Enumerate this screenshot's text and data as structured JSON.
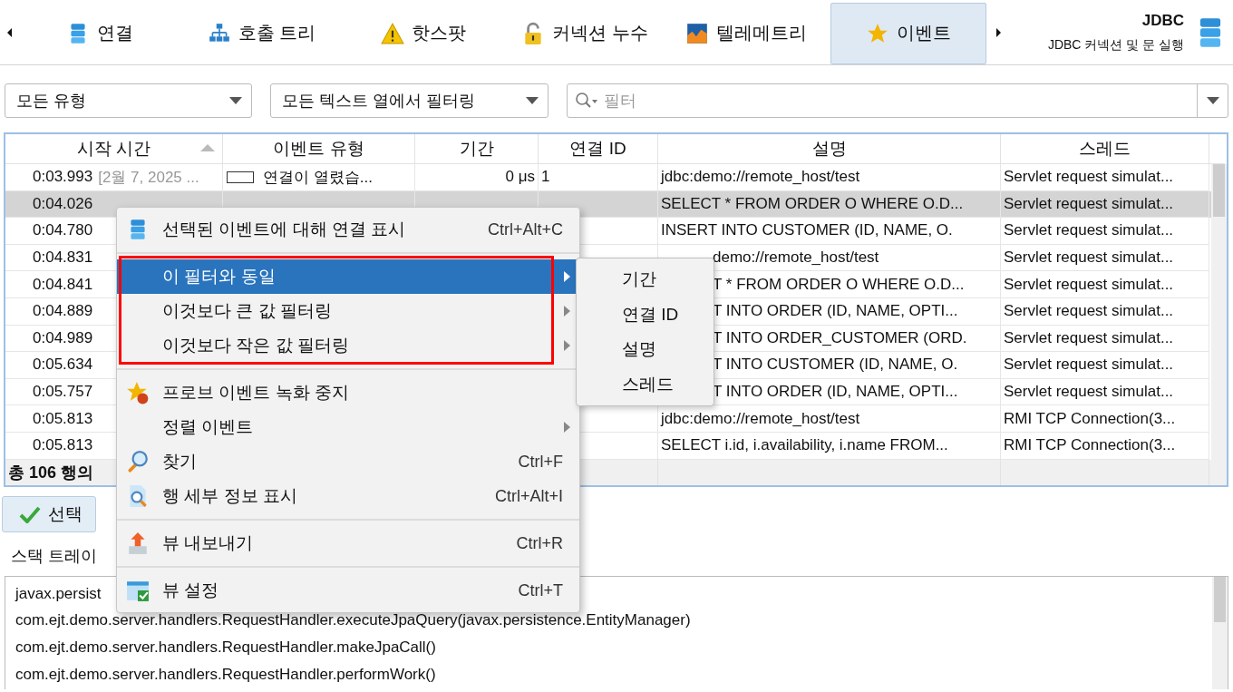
{
  "toolbar": {
    "tabs": [
      {
        "label": "연결",
        "selected": false
      },
      {
        "label": "호출 트리",
        "selected": false
      },
      {
        "label": "핫스팟",
        "selected": false
      },
      {
        "label": "커넥션 누수",
        "selected": false
      },
      {
        "label": "텔레메트리",
        "selected": false
      },
      {
        "label": "이벤트",
        "selected": true
      }
    ]
  },
  "header": {
    "title": "JDBC",
    "subtitle": "JDBC 커넥션 및 문 실행"
  },
  "filters": {
    "type_dropdown": "모든 유형",
    "column_dropdown": "모든 텍스트 열에서 필터링",
    "search": {
      "placeholder": "필터"
    }
  },
  "table": {
    "columns": [
      {
        "label": "시작 시간",
        "sorted": true
      },
      {
        "label": "이벤트 유형",
        "sorted": false
      },
      {
        "label": "기간",
        "sorted": false
      },
      {
        "label": "연결 ID",
        "sorted": false
      },
      {
        "label": "설명",
        "sorted": false
      },
      {
        "label": "스레드",
        "sorted": false
      }
    ],
    "rows": [
      {
        "start": "0:03.993",
        "date": "[2월 7, 2025 ...",
        "event_type": "연결이 열렸습...",
        "color": "#ffffff",
        "duration": "0 μs",
        "connection_id": "1",
        "description": "jdbc:demo://remote_host/test",
        "thread": "Servlet request simulat...",
        "selected": false
      },
      {
        "start": "0:04.026",
        "description": "SELECT * FROM ORDER O WHERE O.D...",
        "thread": "Servlet request simulat...",
        "selected": true
      },
      {
        "start": "0:04.780",
        "description": "INSERT INTO CUSTOMER (ID, NAME, O.",
        "thread": "Servlet request simulat...",
        "selected": false
      },
      {
        "start": "0:04.831",
        "description": "demo://remote_host/test",
        "thread": "Servlet request simulat...",
        "selected": false
      },
      {
        "start": "0:04.841",
        "description": "T * FROM ORDER O WHERE O.D...",
        "thread": "Servlet request simulat...",
        "selected": false
      },
      {
        "start": "0:04.889",
        "description": "T INTO ORDER (ID, NAME, OPTI...",
        "thread": "Servlet request simulat...",
        "selected": false
      },
      {
        "start": "0:04.989",
        "description": "T INTO ORDER_CUSTOMER (ORD.",
        "thread": "Servlet request simulat...",
        "selected": false
      },
      {
        "start": "0:05.634",
        "description": "T INTO CUSTOMER (ID, NAME, O.",
        "thread": "Servlet request simulat...",
        "selected": false
      },
      {
        "start": "0:05.757",
        "description": "T INTO ORDER (ID, NAME, OPTI...",
        "thread": "Servlet request simulat...",
        "selected": false
      },
      {
        "start": "0:05.813",
        "description": "jdbc:demo://remote_host/test",
        "thread": "RMI TCP Connection(3...",
        "selected": false
      },
      {
        "start": "0:05.813",
        "description": "SELECT i.id, i.availability, i.name FROM...",
        "thread": "RMI TCP Connection(3...",
        "selected": false
      }
    ],
    "status": "총 106 행의"
  },
  "select_button": "선택",
  "stack_trace": {
    "label": "스택 트레이",
    "lines": [
      "javax.persist",
      "com.ejt.demo.server.handlers.RequestHandler.executeJpaQuery(javax.persistence.EntityManager)",
      "com.ejt.demo.server.handlers.RequestHandler.makeJpaCall()",
      "com.ejt.demo.server.handlers.RequestHandler.performWork()"
    ]
  },
  "context_menu": {
    "sections": [
      {
        "items": [
          {
            "label": "선택된 이벤트에 대해 연결 표시",
            "shortcut": "Ctrl+Alt+C",
            "submenu": false,
            "selected": false
          }
        ]
      },
      {
        "outlined": true,
        "items": [
          {
            "label": "이 필터와 동일",
            "submenu": true,
            "selected": true
          },
          {
            "label": "이것보다 큰 값 필터링",
            "submenu": true,
            "selected": false
          },
          {
            "label": "이것보다 작은 값 필터링",
            "submenu": true,
            "selected": false
          }
        ]
      },
      {
        "items": [
          {
            "label": "프로브 이벤트 녹화 중지",
            "submenu": false,
            "selected": false
          },
          {
            "label": "정렬 이벤트",
            "submenu": true,
            "selected": false
          },
          {
            "label": "찾기",
            "shortcut": "Ctrl+F",
            "submenu": false,
            "selected": false
          },
          {
            "label": "행 세부 정보 표시",
            "shortcut": "Ctrl+Alt+I",
            "submenu": false,
            "selected": false
          }
        ]
      },
      {
        "items": [
          {
            "label": "뷰 내보내기",
            "shortcut": "Ctrl+R",
            "submenu": false,
            "selected": false
          }
        ]
      },
      {
        "items": [
          {
            "label": "뷰 설정",
            "shortcut": "Ctrl+T",
            "submenu": false,
            "selected": false
          }
        ]
      }
    ],
    "submenu": [
      "기간",
      "연결 ID",
      "설명",
      "스레드"
    ]
  }
}
